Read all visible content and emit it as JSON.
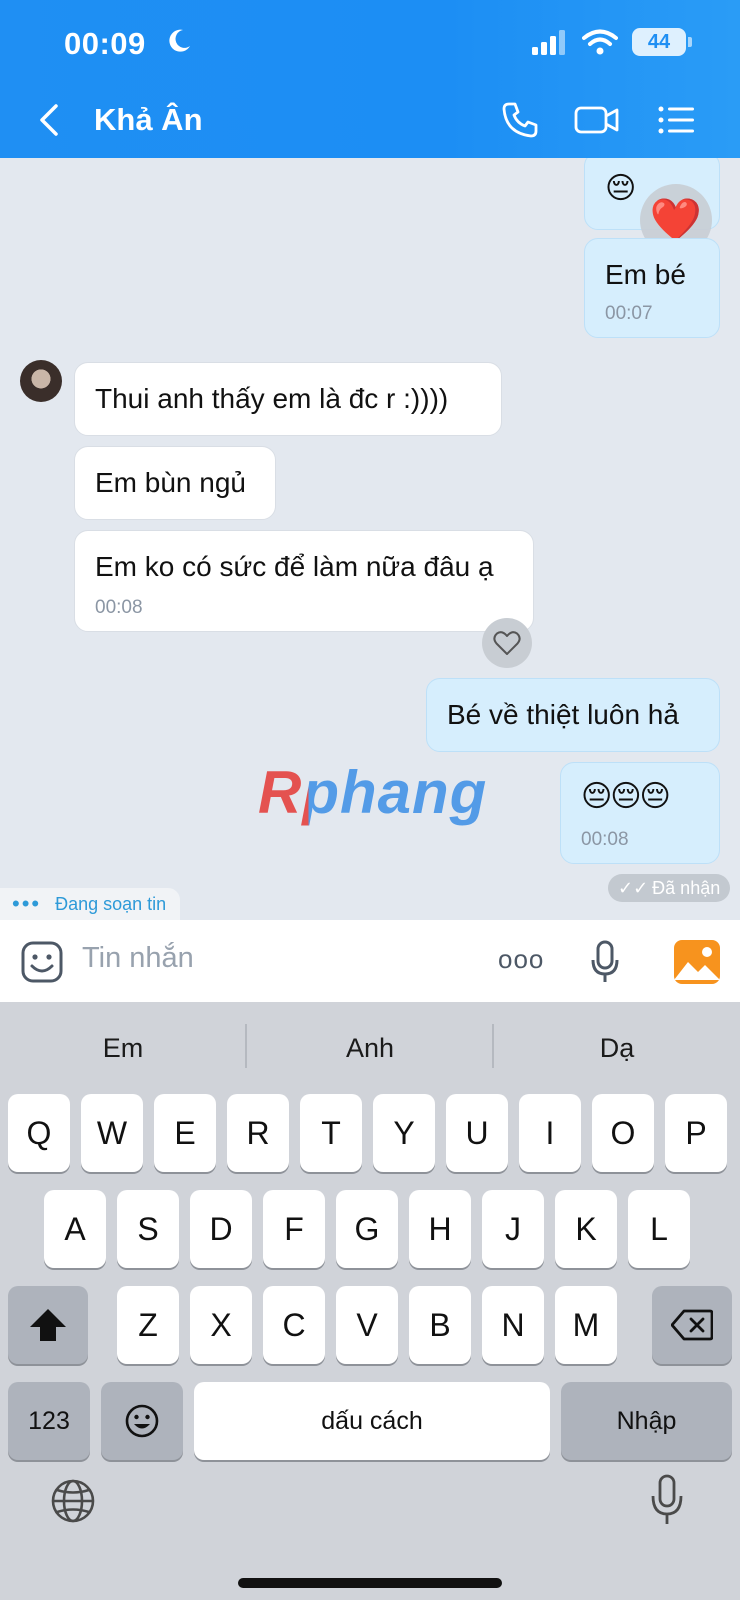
{
  "status_bar": {
    "time": "00:09",
    "battery": "44"
  },
  "header": {
    "contact_name": "Khả Ân"
  },
  "messages": {
    "out_emoji": "😔",
    "out_em_be": {
      "text": "Em bé",
      "time": "00:07"
    },
    "in_1": "Thui anh thấy em là đc r :))))",
    "in_2": "Em bùn ngủ",
    "in_3": {
      "text": "Em ko có sức để làm nữa đâu ạ",
      "time": "00:08"
    },
    "out_be_ve": "Bé về thiệt luôn hả",
    "out_emojis": {
      "text": "😔😔😔",
      "time": "00:08"
    },
    "received_status": "Đã nhận",
    "typing_status": "Đang soạn tin"
  },
  "reaction": "❤️",
  "watermark": "Rphang",
  "input": {
    "placeholder": "Tin nhắn",
    "more": "ooo"
  },
  "keyboard": {
    "suggestions": [
      "Em",
      "Anh",
      "Dạ"
    ],
    "row1": [
      "Q",
      "W",
      "E",
      "R",
      "T",
      "Y",
      "U",
      "I",
      "O",
      "P"
    ],
    "row2": [
      "A",
      "S",
      "D",
      "F",
      "G",
      "H",
      "J",
      "K",
      "L"
    ],
    "row3": [
      "Z",
      "X",
      "C",
      "V",
      "B",
      "N",
      "M"
    ],
    "numbers_key": "123",
    "space_key": "dấu cách",
    "return_key": "Nhập"
  },
  "colors": {
    "header_blue": "#1f8ff3",
    "outgoing_bubble": "#d6eefd",
    "accent_orange": "#f7931e"
  }
}
